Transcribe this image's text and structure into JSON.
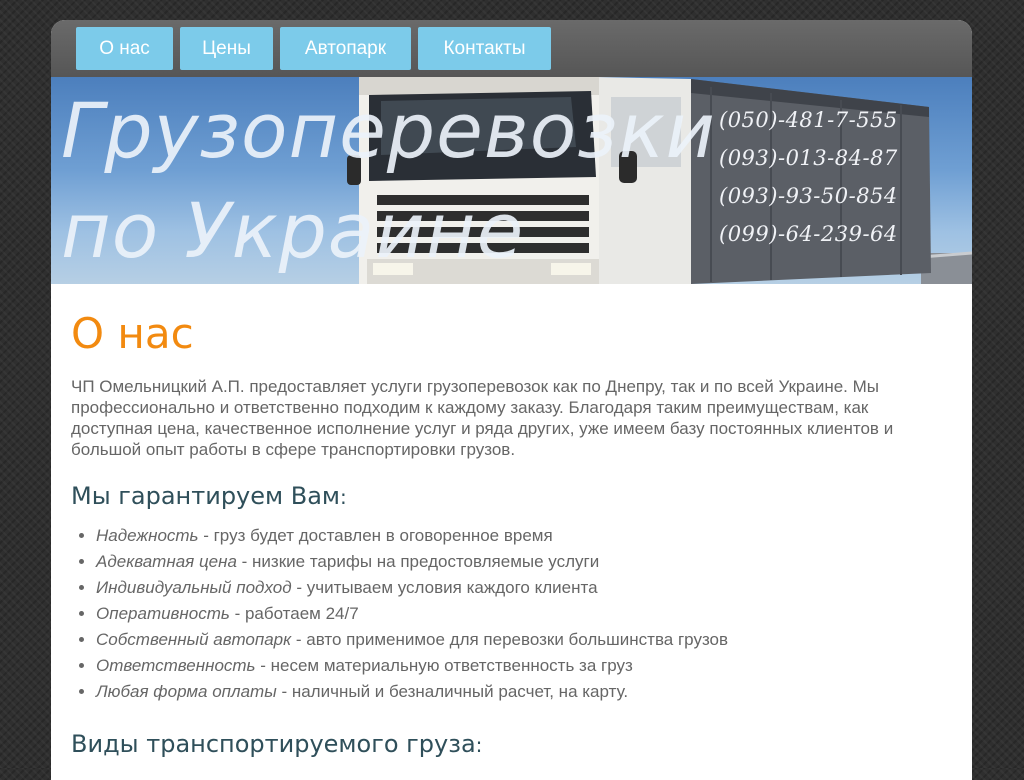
{
  "nav": {
    "items": [
      {
        "label": "О нас"
      },
      {
        "label": "Цены"
      },
      {
        "label": "Автопарк"
      },
      {
        "label": "Контакты"
      }
    ]
  },
  "banner": {
    "headline_line1": "Грузоперевозки",
    "headline_line2": "по Украине",
    "phones": [
      "(050)-481-7-555",
      "(093)-013-84-87",
      "(093)-93-50-854",
      "(099)-64-239-64"
    ]
  },
  "main": {
    "title": "О нас",
    "intro": "ЧП Омельницкий А.П. предоставляет услуги грузоперевозок как по Днепру, так и по всей Украине. Мы профессионально и ответственно подходим к каждому заказу. Благодаря таким преимуществам, как доступная цена, качественное исполнение услуг и ряда других, уже имеем базу постоянных клиентов и большой опыт работы в сфере транспортировки грузов.",
    "guarantee_heading": "Мы гарантируем Вам",
    "guarantee_colon": ":",
    "guarantees": [
      {
        "term": "Надежность",
        "text": " - груз будет доставлен в оговоренное время"
      },
      {
        "term": "Адекватная цена",
        "text": " - низкие тарифы на предостовляемые услуги"
      },
      {
        "term": "Индивидуальный подход",
        "text": " - учитываем условия каждого клиента"
      },
      {
        "term": "Оперативность",
        "text": " - работаем 24/7"
      },
      {
        "term": "Собственный автопарк",
        "text": " - авто применимое для перевозки большинства грузов"
      },
      {
        "term": "Ответственность",
        "text": " - несем материальную ответственность за груз"
      },
      {
        "term": "Любая форма оплаты",
        "text": " - наличный и безналичный расчет, на карту."
      }
    ],
    "cargo_heading": "Виды транспортируемого груза",
    "cargo_colon": ":"
  },
  "colors": {
    "nav_button": "#7ccbea",
    "title_accent": "#f28a10",
    "heading": "#2f4f5a",
    "body_text": "#666666"
  }
}
